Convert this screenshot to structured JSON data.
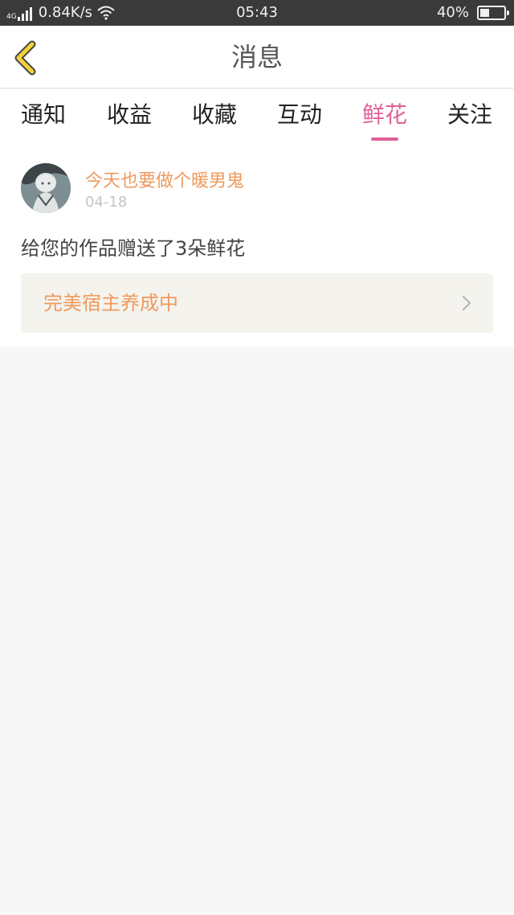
{
  "status_bar": {
    "network": "4G",
    "speed": "0.84K/s",
    "time": "05:43",
    "battery": "40%",
    "battery_level": 0.4
  },
  "header": {
    "title": "消息"
  },
  "tabs": [
    {
      "label": "通知",
      "active": false
    },
    {
      "label": "收益",
      "active": false
    },
    {
      "label": "收藏",
      "active": false
    },
    {
      "label": "互动",
      "active": false
    },
    {
      "label": "鲜花",
      "active": true
    },
    {
      "label": "关注",
      "active": false
    }
  ],
  "message": {
    "username": "今天也要做个暖男鬼",
    "date": "04-18",
    "text": "给您的作品赠送了3朵鲜花",
    "work_title": "完美宿主养成中"
  },
  "colors": {
    "accent": "#e0609a",
    "username": "#ef9a5e",
    "back_arrow": "#f3d33a"
  },
  "icons": [
    "back-arrow-icon",
    "chevron-right-icon",
    "wifi-icon",
    "signal-icon",
    "battery-icon"
  ]
}
